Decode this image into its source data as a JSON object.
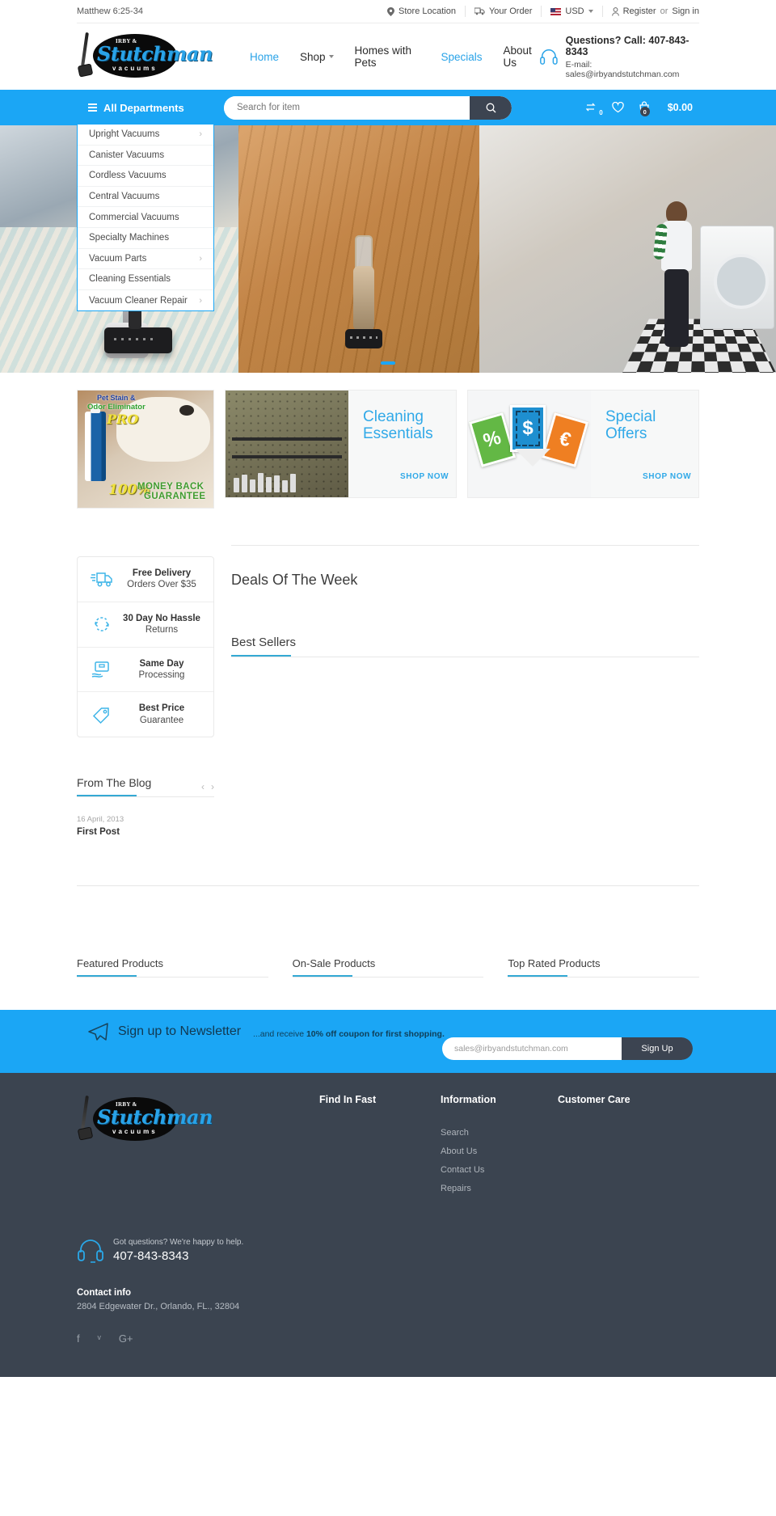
{
  "topbar": {
    "verse": "Matthew 6:25-34",
    "items": [
      {
        "label": "Store Location",
        "icon": "pin-icon"
      },
      {
        "label": "Your Order",
        "icon": "truck-icon"
      },
      {
        "label": "USD",
        "icon": "flag-icon"
      }
    ],
    "account": {
      "icon": "user-icon",
      "register": "Register",
      "or": "or",
      "signin": "Sign in"
    }
  },
  "brand": {
    "top_text": "IRBY &",
    "name": "Stutchman",
    "sub": "vacuums"
  },
  "nav": {
    "items": [
      {
        "label": "Home",
        "active": true,
        "caret": false
      },
      {
        "label": "Shop",
        "active": false,
        "caret": true
      },
      {
        "label": "Homes with Pets",
        "active": false,
        "caret": false
      },
      {
        "label": "Specials",
        "active": true,
        "caret": false
      },
      {
        "label": "About Us",
        "active": false,
        "caret": false
      }
    ]
  },
  "contact": {
    "phone_line": "Questions? Call: 407-843-8343",
    "email_line": "E-mail: sales@irbyandstutchman.com"
  },
  "search": {
    "departments_label": "All Departments",
    "placeholder": "Search for item",
    "compare_count": "0",
    "cart_count": "0",
    "cart_total": "$0.00"
  },
  "departments": [
    {
      "label": "Upright Vacuums",
      "arrow": true
    },
    {
      "label": "Canister Vacuums",
      "arrow": false
    },
    {
      "label": "Cordless Vacuums",
      "arrow": false
    },
    {
      "label": "Central Vacuums",
      "arrow": false
    },
    {
      "label": "Commercial Vacuums",
      "arrow": false
    },
    {
      "label": "Specialty Machines",
      "arrow": false
    },
    {
      "label": "Vacuum Parts",
      "arrow": true
    },
    {
      "label": "Cleaning Essentials",
      "arrow": false
    },
    {
      "label": "Vacuum Cleaner Repair",
      "arrow": true
    }
  ],
  "hero": {
    "slide_indicator": "1"
  },
  "promos": {
    "pet": {
      "line1": "Pet Stain &",
      "line2": "Odor Eliminator",
      "line3": "PRO",
      "guarantee_pct": "100%",
      "guarantee_l1": "MONEY BACK",
      "guarantee_l2": "GUARANTEE"
    },
    "cleaning": {
      "title_l1": "Cleaning",
      "title_l2": "Essentials",
      "cta": "SHOP NOW"
    },
    "offers": {
      "title_l1": "Special",
      "title_l2": "Offers",
      "cta": "SHOP NOW",
      "symbols": [
        "%",
        "$",
        "€"
      ]
    }
  },
  "services": [
    {
      "icon": "delivery-truck-icon",
      "title": "Free Delivery",
      "subtitle": "Orders Over $35"
    },
    {
      "icon": "returns-arrows-icon",
      "title": "30 Day No Hassle",
      "subtitle": "Returns"
    },
    {
      "icon": "package-hand-icon",
      "title": "Same Day",
      "subtitle": "Processing"
    },
    {
      "icon": "price-tag-icon",
      "title": "Best Price",
      "subtitle": "Guarantee"
    }
  ],
  "sections": {
    "deals_title": "Deals Of The Week",
    "best_sellers_title": "Best Sellers",
    "blog_title": "From The Blog"
  },
  "blog": {
    "posts": [
      {
        "date": "16 April, 2013",
        "title": "First Post"
      }
    ]
  },
  "product_tabs": [
    {
      "label": "Featured Products"
    },
    {
      "label": "On-Sale Products"
    },
    {
      "label": "Top Rated Products"
    }
  ],
  "newsletter": {
    "icon": "paper-plane-icon",
    "title": "Sign up to Newsletter",
    "sub_prefix": "...and receive ",
    "sub_bold": "10% off coupon for first shopping.",
    "email_value": "sales@irbyandstutchman.com",
    "button": "Sign Up"
  },
  "footer": {
    "columns": [
      {
        "title": "Find In Fast",
        "links": []
      },
      {
        "title": "Information",
        "links": [
          "Search",
          "About Us",
          "Contact Us",
          "Repairs"
        ]
      },
      {
        "title": "Customer Care",
        "links": []
      }
    ],
    "support": {
      "question": "Got questions? We're happy to help.",
      "phone": "407-843-8343"
    },
    "contact_heading": "Contact info",
    "contact_address": "2804 Edgewater Dr., Orlando, FL., 32804",
    "social": [
      {
        "name": "facebook-icon",
        "glyph": "f"
      },
      {
        "name": "twitter-icon",
        "glyph": "ᵛ"
      },
      {
        "name": "google-plus-icon",
        "glyph": "G+"
      }
    ]
  },
  "colors": {
    "accent": "#1ba6f5",
    "dark": "#3b4450",
    "tab_underline": "#34a9d4"
  }
}
